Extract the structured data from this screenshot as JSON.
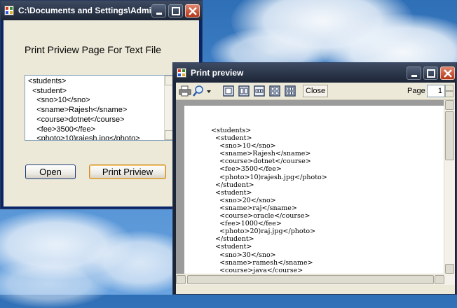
{
  "form_window": {
    "title": "C:\\Documents and Settings\\Admi...",
    "heading": "Print Priview Page For Text File",
    "textbox_lines": [
      "<students>",
      "  <student>",
      "    <sno>10</sno>",
      "    <sname>Rajesh</sname>",
      "    <course>dotnet</course>",
      "    <fee>3500</fee>",
      "    <photo>10)rajesh.jpg</photo>"
    ],
    "open_label": "Open",
    "print_label": "Print Priview"
  },
  "preview_window": {
    "title": "Print preview",
    "close_label": "Close",
    "page_label": "Page",
    "page_value": "1",
    "document_lines": [
      "<students>",
      "  <student>",
      "    <sno>10</sno>",
      "    <sname>Rajesh</sname>",
      "    <course>dotnet</course>",
      "    <fee>3500</fee>",
      "    <photo>10)rajesh.jpg</photo>",
      "  </student>",
      "  <student>",
      "    <sno>20</sno>",
      "    <sname>raj</sname>",
      "    <course>oracle</course>",
      "    <fee>1000</fee>",
      "    <photo>20)raj.jpg</photo>",
      "  </student>",
      "  <student>",
      "    <sno>30</sno>",
      "    <sname>ramesh</sname>",
      "    <course>java</course>"
    ]
  },
  "colors": {
    "titlebar_dark": "#1c2536",
    "window_bg": "#ece9d8",
    "close_red": "#c8452a",
    "sky": "#4a8bd0"
  },
  "icons": [
    "app-icon",
    "minimize-icon",
    "maximize-icon",
    "close-icon",
    "print-icon",
    "zoom-icon",
    "page-layout-icon"
  ]
}
